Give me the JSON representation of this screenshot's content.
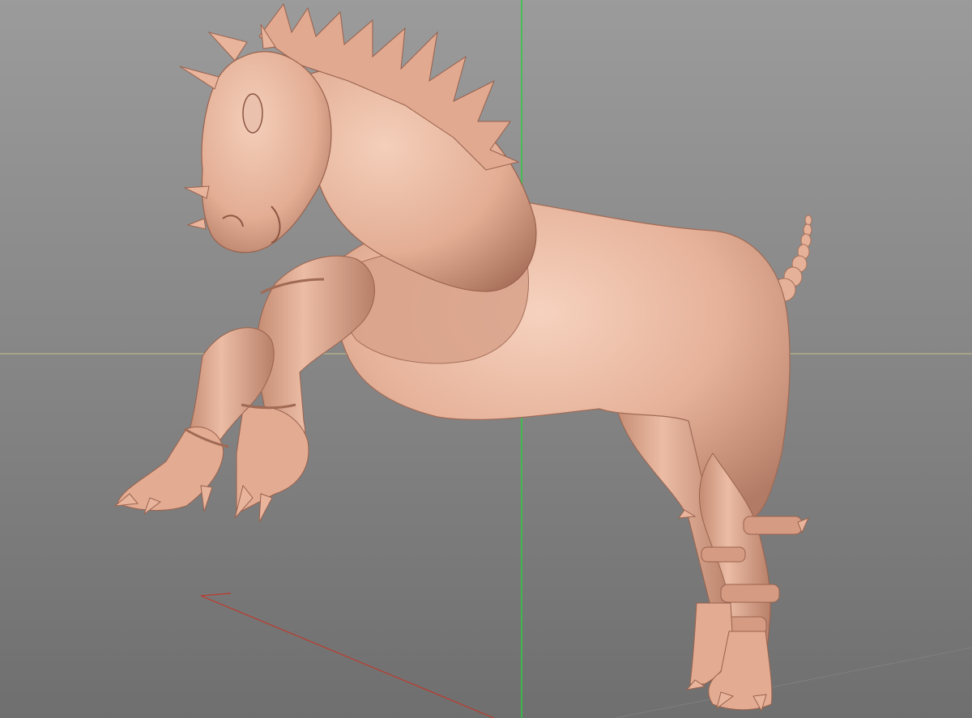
{
  "app": {
    "view": "3D viewport",
    "projection": "perspective"
  },
  "viewport": {
    "background_top": "#9a9a9a",
    "background_bottom": "#707070",
    "grid": true,
    "axes": {
      "x_axis_color": "#c0392b",
      "y_axis_color": "#2ecc40",
      "horizon_color": "#b3ad8a"
    }
  },
  "model": {
    "name": "",
    "material_color": "#e8b49c",
    "shadow_color": "#a9715c",
    "highlight_color": "#f6d0bc",
    "icon": "sculpted-horse-mesh"
  }
}
